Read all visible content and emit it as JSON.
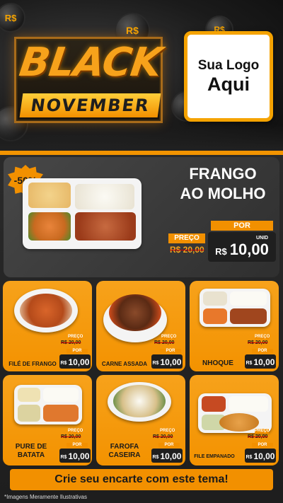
{
  "header": {
    "currency_symbol": "R$",
    "campaign_word1": "BLACK",
    "campaign_word2": "NOVEMBER",
    "logo_line1": "Sua Logo",
    "logo_line2": "Aqui",
    "accent_color": "#f29000"
  },
  "featured": {
    "discount": "-50%",
    "title_line1": "FRANGO",
    "title_line2": "AO MOLHO",
    "preco_label": "PREÇO",
    "old_price": "R$ 20,00",
    "por_label": "POR",
    "unid_label": "UNID",
    "currency": "R$",
    "price": "10,00"
  },
  "cards": [
    {
      "name": "FILÉ DE FRANGO",
      "preco_label": "PREÇO",
      "old_price": "R$ 20,00",
      "por_label": "POR",
      "unid_label": "UNID",
      "currency": "R$",
      "price": "10,00"
    },
    {
      "name": "CARNE ASSADA",
      "preco_label": "PREÇO",
      "old_price": "R$ 20,00",
      "por_label": "POR",
      "unid_label": "UNID",
      "currency": "R$",
      "price": "10,00"
    },
    {
      "name": "NHOQUE",
      "preco_label": "PREÇO",
      "old_price": "R$ 20,00",
      "por_label": "POR",
      "unid_label": "UNID",
      "currency": "R$",
      "price": "10,00"
    },
    {
      "name": "PURE DE BATATA",
      "preco_label": "PREÇO",
      "old_price": "R$ 20,00",
      "por_label": "POR",
      "unid_label": "UNID",
      "currency": "R$",
      "price": "10,00"
    },
    {
      "name": "FAROFA CASEIRA",
      "preco_label": "PREÇO",
      "old_price": "R$ 20,00",
      "por_label": "POR",
      "unid_label": "UNID",
      "currency": "R$",
      "price": "10,00"
    },
    {
      "name": "FILE EMPANADO",
      "preco_label": "PREÇO",
      "old_price": "R$ 20,00",
      "por_label": "POR",
      "unid_label": "UNID",
      "currency": "R$",
      "price": "10,00"
    }
  ],
  "footer": {
    "cta": "Crie seu encarte com este tema!",
    "disclaimer": "*Imagens Meramente Ilustrativas"
  }
}
